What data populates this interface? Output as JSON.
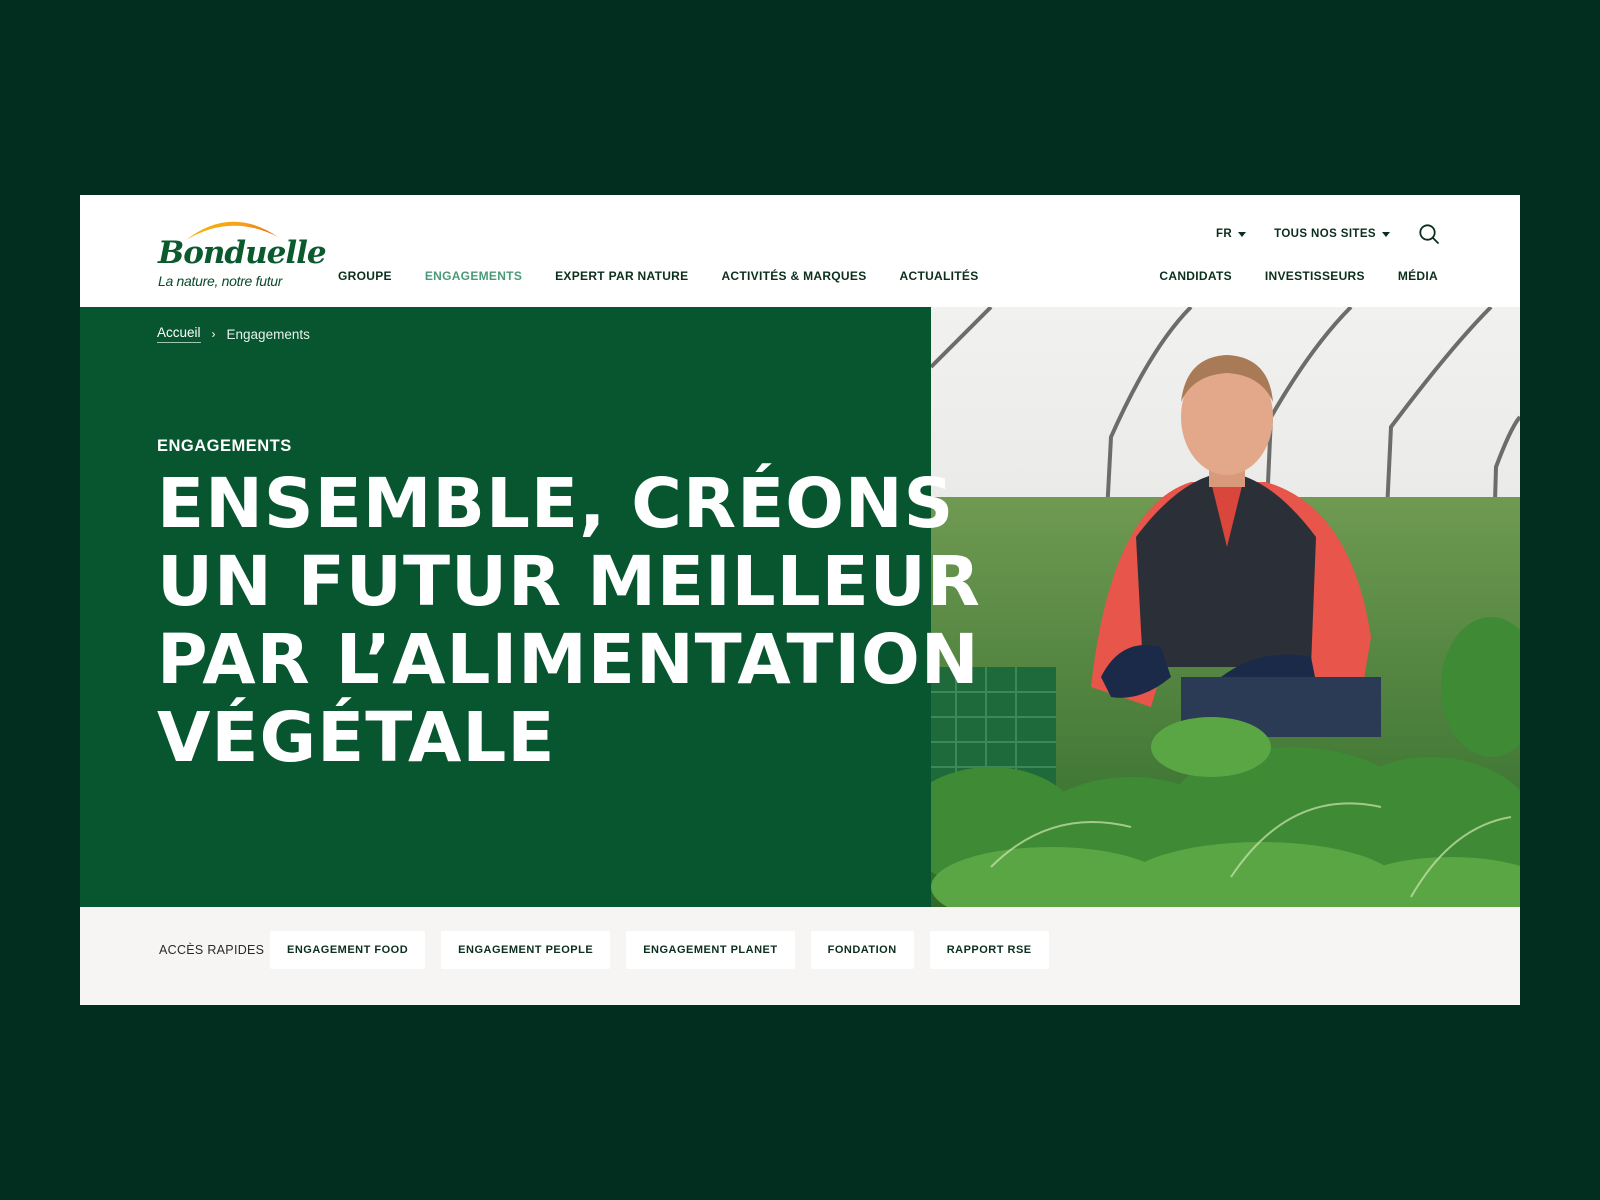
{
  "brand": {
    "name": "Bonduelle",
    "tagline": "La nature, notre futur"
  },
  "utility": {
    "language": "FR",
    "sites": "TOUS NOS SITES"
  },
  "nav": {
    "main": [
      {
        "label": "GROUPE",
        "active": false
      },
      {
        "label": "ENGAGEMENTS",
        "active": true
      },
      {
        "label": "EXPERT PAR NATURE",
        "active": false
      },
      {
        "label": "ACTIVITÉS & MARQUES",
        "active": false
      },
      {
        "label": "ACTUALITÉS",
        "active": false
      }
    ],
    "secondary": [
      "CANDIDATS",
      "INVESTISSEURS",
      "MÉDIA"
    ]
  },
  "breadcrumb": {
    "home": "Accueil",
    "current": "Engagements"
  },
  "hero": {
    "eyebrow": "ENGAGEMENTS",
    "headline": [
      "ENSEMBLE, CRÉONS",
      "UN FUTUR MEILLEUR",
      "PAR L’ALIMENTATION",
      "VÉGÉTALE"
    ]
  },
  "quick_access": {
    "label": "ACCÈS RAPIDES",
    "links": [
      "ENGAGEMENT FOOD",
      "ENGAGEMENT PEOPLE",
      "ENGAGEMENT PLANET",
      "FONDATION",
      "RAPPORT RSE"
    ]
  },
  "colors": {
    "page_bg": "#012e1e",
    "hero_green": "#075630",
    "active_nav": "#4a9a78",
    "text_dark": "#0b2e1d",
    "quick_bg": "#f6f5f3"
  }
}
